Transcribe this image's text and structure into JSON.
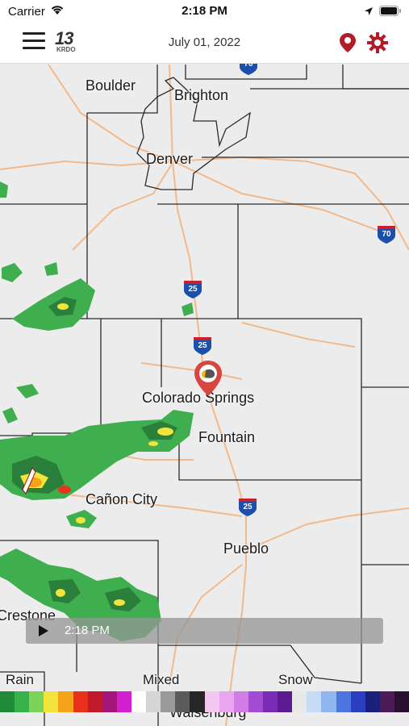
{
  "status_bar": {
    "carrier": "Carrier",
    "time": "2:18 PM"
  },
  "header": {
    "date": "July 01, 2022",
    "logo_number": "13",
    "logo_text": "KRDO"
  },
  "map": {
    "cities": [
      "Boulder",
      "Brighton",
      "Denver",
      "Colorado Springs",
      "Fountain",
      "Cañon City",
      "Pueblo",
      "Crestone",
      "Walsenburg"
    ],
    "highway_shields": [
      "70",
      "25",
      "25",
      "25",
      "70"
    ]
  },
  "timeline": {
    "time": "2:18 PM"
  },
  "legend": {
    "labels": [
      "Rain",
      "Mixed",
      "Snow"
    ],
    "colors": [
      "#1f8a3a",
      "#35b24a",
      "#7cd35a",
      "#f2e43a",
      "#f5a31a",
      "#e8321c",
      "#c21a2a",
      "#a4167a",
      "#d21fd0",
      "#ffffff",
      "#d5d5d5",
      "#9a9a9a",
      "#5b5b5b",
      "#262626",
      "#f5c6f2",
      "#e9a5ee",
      "#d27ce6",
      "#a24bd3",
      "#7a2bb6",
      "#5c1a90",
      "#e8e8e8",
      "#c7dbf5",
      "#8fb6ef",
      "#4d75e0",
      "#2a3fbf",
      "#191f7a",
      "#4b1c55",
      "#2a0f30"
    ]
  },
  "colors": {
    "pin": "#c8202e",
    "radar_green": "#2aa84a",
    "roads": "#f3b98a",
    "borders": "#222222"
  }
}
